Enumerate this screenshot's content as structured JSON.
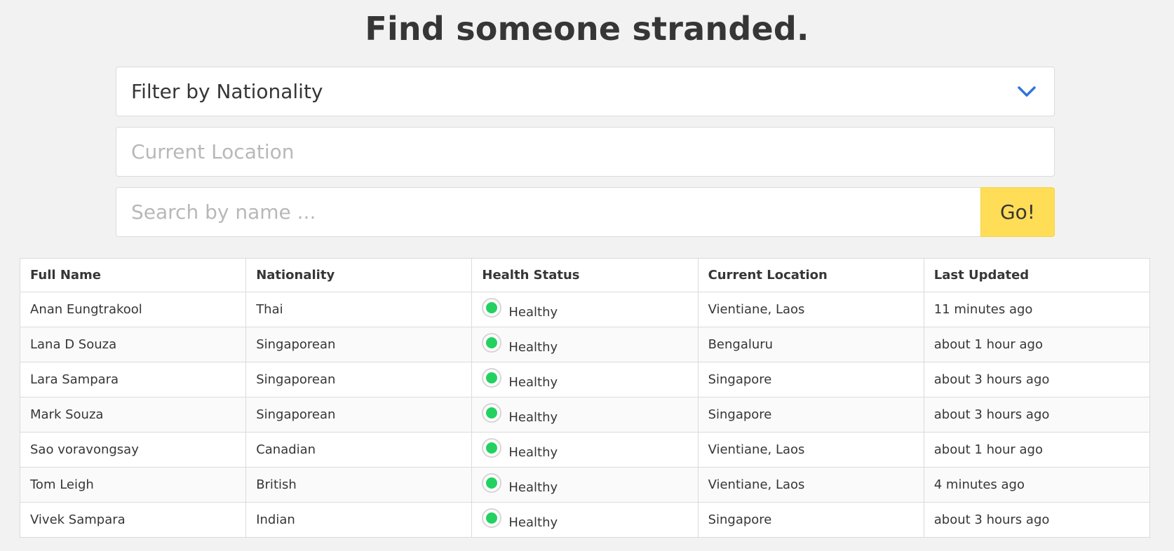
{
  "page": {
    "title": "Find someone stranded."
  },
  "filters": {
    "nationality_select_label": "Filter by Nationality",
    "location_placeholder": "Current Location",
    "location_value": "",
    "search_placeholder": "Search by name ...",
    "search_value": "",
    "go_label": "Go!"
  },
  "colors": {
    "accent_blue": "#3273dc",
    "go_button_yellow": "#ffdd57",
    "healthy_green": "#23d160"
  },
  "icons": {
    "nationality_select": "chevron-down-icon",
    "health_status": "status-dot-icon"
  },
  "table": {
    "columns": [
      "Full Name",
      "Nationality",
      "Health Status",
      "Current Location",
      "Last Updated"
    ],
    "rows": [
      [
        "Anan Eungtrakool",
        "Thai",
        "Healthy",
        "Vientiane, Laos",
        "11 minutes ago"
      ],
      [
        "Lana D Souza",
        "Singaporean",
        "Healthy",
        "Bengaluru",
        "about 1 hour ago"
      ],
      [
        "Lara Sampara",
        "Singaporean",
        "Healthy",
        "Singapore",
        "about 3 hours ago"
      ],
      [
        "Mark Souza",
        "Singaporean",
        "Healthy",
        "Singapore",
        "about 3 hours ago"
      ],
      [
        "Sao voravongsay",
        "Canadian",
        "Healthy",
        "Vientiane, Laos",
        "about 1 hour ago"
      ],
      [
        "Tom Leigh",
        "British",
        "Healthy",
        "Vientiane, Laos",
        "4 minutes ago"
      ],
      [
        "Vivek Sampara",
        "Indian",
        "Healthy",
        "Singapore",
        "about 3 hours ago"
      ]
    ]
  }
}
